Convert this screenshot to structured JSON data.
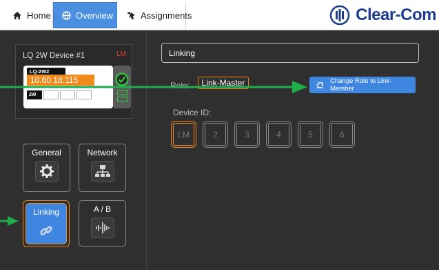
{
  "nav": {
    "home": "Home",
    "overview": "Overview",
    "assignments": "Assignments",
    "brand": "Clear-Com"
  },
  "device": {
    "title": "LQ 2W Device #1",
    "badge": "LM",
    "model": "LQ-2W2",
    "ip": "10.60.18.115",
    "port_label": "2W"
  },
  "menu": {
    "general": "General",
    "network": "Network",
    "linking": "Linking",
    "ab": "A / B"
  },
  "panel": {
    "title": "Linking",
    "role_label": "Role:",
    "role_value": "Link-Master",
    "change_button": "Change Role to Link-Member",
    "device_id_label": "Device ID:",
    "device_ids": [
      "LM",
      "2",
      "3",
      "4",
      "5",
      "6"
    ],
    "selected_device_id": "LM"
  },
  "colors": {
    "accent_blue": "#3f86e0",
    "accent_orange": "#f08a1c",
    "annotation_green": "#1fae4b",
    "background_dark": "#2f2f2f",
    "brand_blue": "#1f3d8c"
  },
  "icons": {
    "home": "home-icon",
    "overview": "globe-icon",
    "assignments": "assignments-icon",
    "general": "gear-icon",
    "network": "network-icon",
    "linking": "link-icon",
    "ab": "waveform-icon",
    "change_role": "swap-icon",
    "status": "check-icon"
  }
}
